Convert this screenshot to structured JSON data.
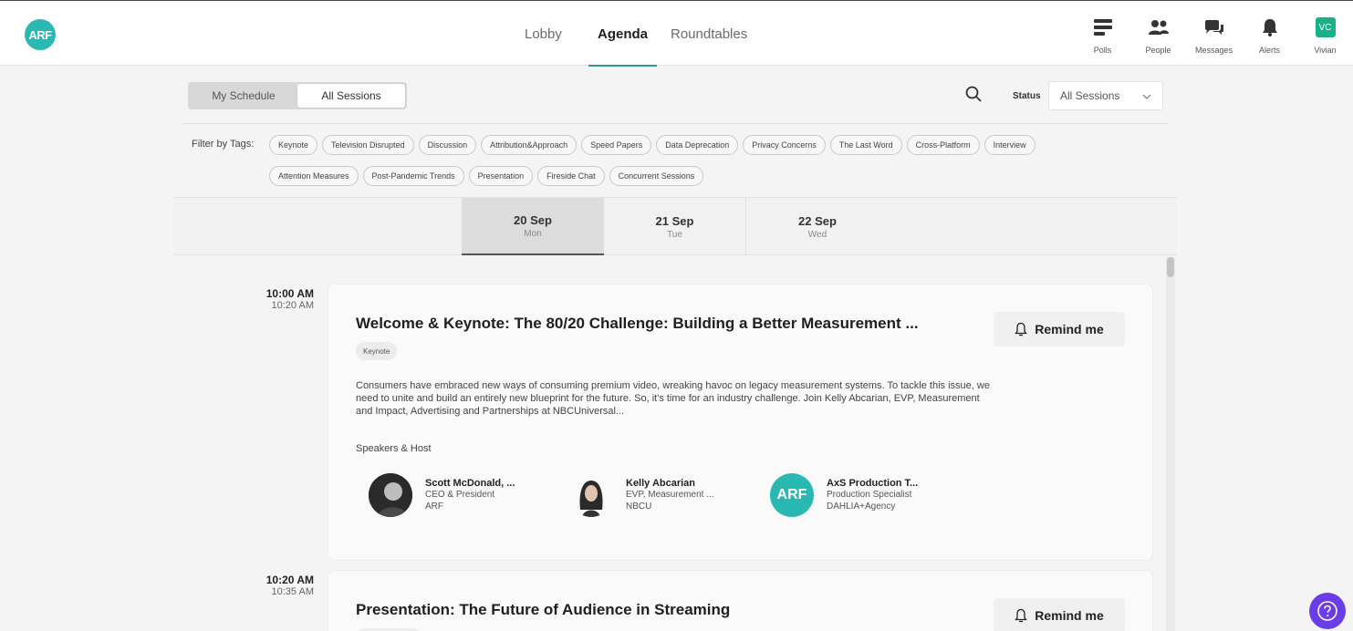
{
  "app": {
    "logo_text": "ARF"
  },
  "nav": {
    "tabs": [
      {
        "label": "Lobby"
      },
      {
        "label": "Agenda"
      },
      {
        "label": "Roundtables"
      }
    ]
  },
  "top_icons": [
    {
      "label": "Polls",
      "icon": "polls-icon"
    },
    {
      "label": "People",
      "icon": "people-icon"
    },
    {
      "label": "Messages",
      "icon": "messages-icon"
    },
    {
      "label": "Alerts",
      "icon": "bell-icon"
    },
    {
      "label": "Vivian",
      "icon": "user-avatar",
      "initials": "VC"
    }
  ],
  "toolbar": {
    "toggle": {
      "my_schedule": "My Schedule",
      "all_sessions": "All Sessions"
    },
    "status_label": "Status",
    "status_value": "All Sessions"
  },
  "filters": {
    "label": "Filter by Tags:",
    "tags": [
      "Keynote",
      "Television Disrupted",
      "Discussion",
      "Attribution&Approach",
      "Speed Papers",
      "Data Deprecation",
      "Privacy Concerns",
      "The Last Word",
      "Cross-Platform",
      "Interview",
      "Attention Measures",
      "Post-Pandemic Trends",
      "Presentation",
      "Fireside Chat",
      "Concurrent Sessions"
    ]
  },
  "dates": [
    {
      "date": "20 Sep",
      "weekday": "Mon",
      "active": true
    },
    {
      "date": "21 Sep",
      "weekday": "Tue",
      "active": false
    },
    {
      "date": "22 Sep",
      "weekday": "Wed",
      "active": false
    }
  ],
  "sessions": [
    {
      "start": "10:00 AM",
      "end": "10:20 AM",
      "title": "Welcome & Keynote: The 80/20 Challenge: Building a Better Measurement ...",
      "tag": "Keynote",
      "remind_label": "Remind me",
      "description": "Consumers have embraced new ways of consuming premium video, wreaking havoc on legacy measurement systems. To tackle this issue, we need to unite and build an entirely new blueprint for the future. So, it's time for an industry challenge. Join Kelly Abcarian, EVP, Measurement and Impact, Advertising and Partnerships at NBCUniversal...",
      "speakers_heading": "Speakers & Host",
      "speakers": [
        {
          "name": "Scott McDonald, ...",
          "role": "CEO & President",
          "org": "ARF"
        },
        {
          "name": "Kelly Abcarian",
          "role": "EVP, Measurement ...",
          "org": "NBCU"
        },
        {
          "name": "AxS Production T...",
          "role": "Production Specialist",
          "org": "DAHLIA+Agency",
          "logo_text": "ARF"
        }
      ]
    },
    {
      "start": "10:20 AM",
      "end": "10:35 AM",
      "title": "Presentation: The Future of Audience in Streaming",
      "remind_label": "Remind me"
    }
  ],
  "colors": {
    "accent": "#2a9a94",
    "logo": "#2ab9b2",
    "help": "#6a3de8",
    "avatar": "#1ab08a"
  }
}
